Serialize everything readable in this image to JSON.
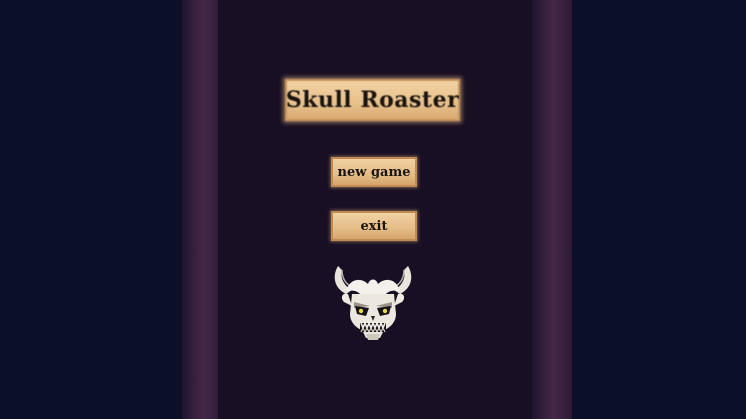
{
  "game": {
    "title": "Skull Roaster"
  },
  "menu": {
    "new_game_label": "new game",
    "exit_label": "exit"
  },
  "emblem": {
    "icon": "horned-skull-icon"
  },
  "colors": {
    "background": "#0b1028",
    "panel": "#190f24",
    "pillar": "#3a2140",
    "plate": "#e7c08a",
    "text": "#1a1410"
  }
}
